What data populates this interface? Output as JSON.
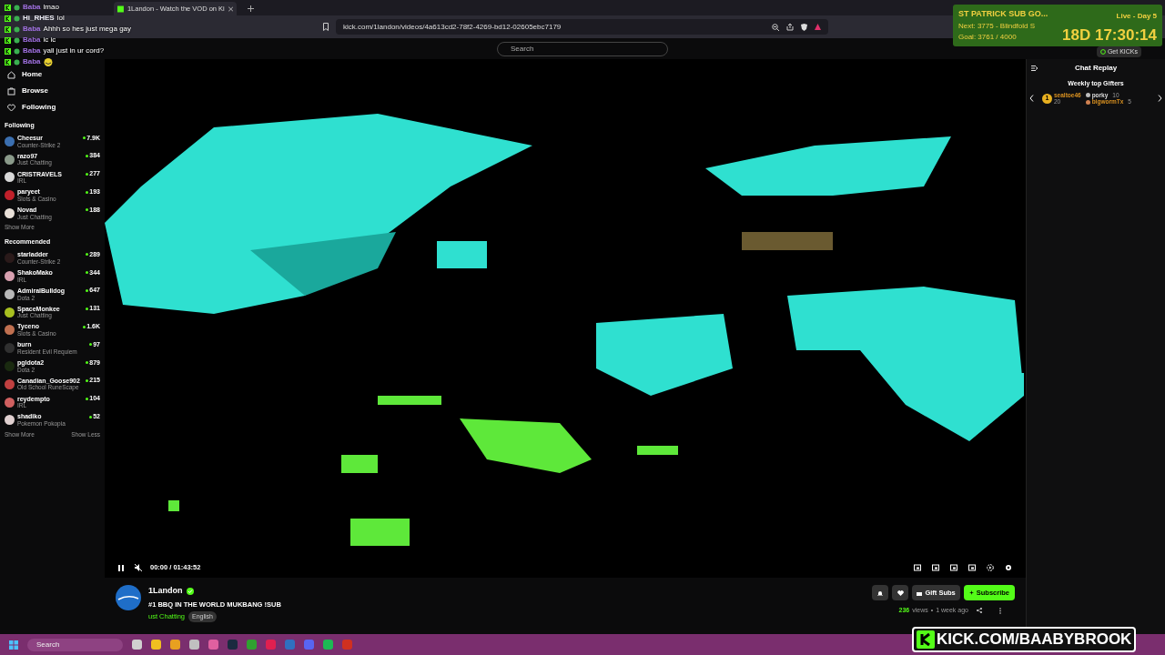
{
  "browser": {
    "tab_title": "1Landon - Watch the VOD on Ki",
    "url": "kick.com/1landon/videos/4a613cd2-78f2-4269-bd12-02605ebc7179"
  },
  "header": {
    "search_placeholder": "Search",
    "get_kicks": "Get KICKs"
  },
  "nav": [
    {
      "label": "Home",
      "kind": "home"
    },
    {
      "label": "Browse",
      "kind": "browse"
    },
    {
      "label": "Following",
      "kind": "heart"
    }
  ],
  "following": {
    "title": "Following",
    "show_more": "Show More",
    "channels": [
      {
        "name": "Cheesur",
        "category": "Counter-Strike 2",
        "viewers": "7.9K",
        "color": "#3b6fb0"
      },
      {
        "name": "razo97",
        "category": "Just Chatting",
        "viewers": "384",
        "color": "#8a9a8a"
      },
      {
        "name": "CRISTRAVELS",
        "category": "IRL",
        "viewers": "277",
        "color": "#d8d8d8"
      },
      {
        "name": "paryeet",
        "category": "Slots & Casino",
        "viewers": "193",
        "color": "#c0202a"
      },
      {
        "name": "Novad",
        "category": "Just Chatting",
        "viewers": "188",
        "color": "#e8e0d8"
      }
    ]
  },
  "recommended": {
    "title": "Recommended",
    "show_more": "Show More",
    "show_less": "Show Less",
    "channels": [
      {
        "name": "starladder",
        "category": "Counter-Strike 2",
        "viewers": "289",
        "color": "#2a1a1a"
      },
      {
        "name": "ShakoMako",
        "category": "IRL",
        "viewers": "344",
        "color": "#d8a0b0"
      },
      {
        "name": "AdmiralBulldog",
        "category": "Dota 2",
        "viewers": "647",
        "color": "#b8b8b8"
      },
      {
        "name": "SpaceMonkee",
        "category": "Just Chatting",
        "viewers": "131",
        "color": "#a8c020"
      },
      {
        "name": "Tyceno",
        "category": "Slots & Casino",
        "viewers": "1.6K",
        "color": "#c07050"
      },
      {
        "name": "burn",
        "category": "Resident Evil Requiem",
        "viewers": "97",
        "color": "#303030"
      },
      {
        "name": "pgldota2",
        "category": "Dota 2",
        "viewers": "879",
        "color": "#1a2a10"
      },
      {
        "name": "Canadian_Goose902",
        "category": "Old School RuneScape",
        "viewers": "215",
        "color": "#c04040"
      },
      {
        "name": "reydempto",
        "category": "IRL",
        "viewers": "104",
        "color": "#d06060"
      },
      {
        "name": "shadiko",
        "category": "Pokemon Pokopia",
        "viewers": "52",
        "color": "#e0d0d0"
      }
    ]
  },
  "player": {
    "time": "00:00 / 01:43:52"
  },
  "channel": {
    "name": "1Landon",
    "title": "#1 BBQ IN THE WORLD MUKBANG !SUB",
    "category": "ust Chatting",
    "tag": "English",
    "views": "236",
    "views_label": "views",
    "separator": "•",
    "age": "1 week ago",
    "gift": "Gift Subs",
    "subscribe": "Subscribe"
  },
  "chat_panel": {
    "title": "Chat Replay",
    "gifters_title": "Weekly top Gifters",
    "gifters": [
      {
        "name": "sealtoe46",
        "count": "20",
        "badge": "1"
      },
      {
        "name": "porky",
        "count": "10"
      },
      {
        "name": "bigwormTx",
        "count": "5"
      }
    ]
  },
  "overlay_chat": [
    {
      "user": "Baba",
      "text": "lmao",
      "color": "#a070e0"
    },
    {
      "user": "Hi_RHES",
      "text": "lol",
      "color": "#e8e8f0"
    },
    {
      "user": "Baba",
      "text": "Ahhh so hes just mega gay",
      "color": "#a070e0"
    },
    {
      "user": "Baba",
      "text": "ic ic",
      "color": "#a070e0"
    },
    {
      "user": "Baba",
      "text": "yall just in ur cord?",
      "color": "#a070e0"
    },
    {
      "user": "Baba",
      "color": "#a070e0"
    }
  ],
  "sub_goal": {
    "title": "ST PATRICK SUB GO...",
    "next": "Next: 3775 - Blindfold S",
    "goal": "Goal: 3761 / 4000",
    "live": "Live - Day 5",
    "timer": "18D 17:30:14"
  },
  "banner": "KICK.COM/BAABYBROOK",
  "taskbar": {
    "search_placeholder": "Search"
  }
}
